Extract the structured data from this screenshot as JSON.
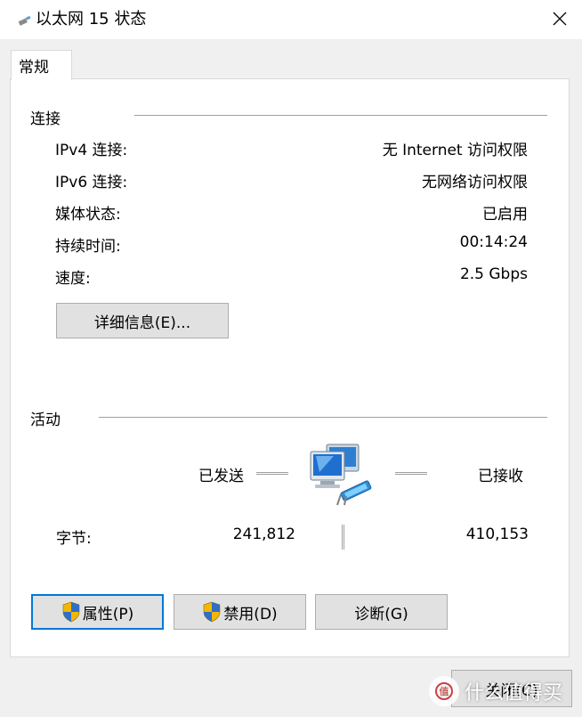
{
  "window": {
    "title": "以太网 15 状态",
    "icon": "network-adapter-icon",
    "close_icon": "close-icon"
  },
  "tabs": [
    {
      "label": "常规",
      "selected": true
    }
  ],
  "connection": {
    "section_title": "连接",
    "rows": [
      {
        "label": "IPv4 连接:",
        "value": "无 Internet 访问权限"
      },
      {
        "label": "IPv6 连接:",
        "value": "无网络访问权限"
      },
      {
        "label": "媒体状态:",
        "value": "已启用"
      },
      {
        "label": "持续时间:",
        "value": "00:14:24"
      },
      {
        "label": "速度:",
        "value": "2.5 Gbps"
      }
    ],
    "details_button": "详细信息(E)..."
  },
  "activity": {
    "section_title": "活动",
    "sent_label": "已发送",
    "received_label": "已接收",
    "bytes_label": "字节:",
    "bytes_sent": "241,812",
    "bytes_received": "410,153",
    "icon": "network-computers-icon"
  },
  "buttons": {
    "properties": "属性(P)",
    "disable": "禁用(D)",
    "diagnose": "诊断(G)",
    "close": "关闭(C)",
    "shield_icon": "uac-shield-icon"
  },
  "watermark": {
    "text": "什么值得买"
  },
  "colors": {
    "focus_border": "#0078d7",
    "button_face": "#e1e1e1",
    "panel_bg": "#ffffff",
    "window_bg": "#f0f0f0"
  }
}
